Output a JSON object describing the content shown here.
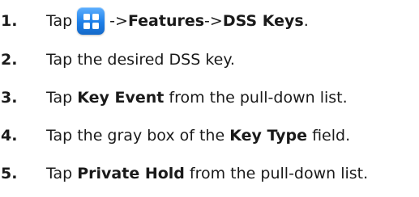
{
  "steps": [
    {
      "number": "1.",
      "parts": {
        "a": "Tap",
        "icon": "menu-grid-icon",
        "b": "->",
        "c": "Features",
        "d": "->",
        "e": "DSS Keys",
        "f": "."
      }
    },
    {
      "number": "2.",
      "parts": {
        "a": "Tap the desired DSS key."
      }
    },
    {
      "number": "3.",
      "parts": {
        "a": "Tap ",
        "b": "Key Event",
        "c": " from the pull-down list."
      }
    },
    {
      "number": "4.",
      "parts": {
        "a": "Tap the gray box of the ",
        "b": "Key Type",
        "c": " field."
      }
    },
    {
      "number": "5.",
      "parts": {
        "a": "Tap ",
        "b": "Private Hold",
        "c": " from the pull-down list."
      }
    }
  ],
  "colors": {
    "icon_bg": "#1e7fe8",
    "text": "#1a1a1a"
  }
}
